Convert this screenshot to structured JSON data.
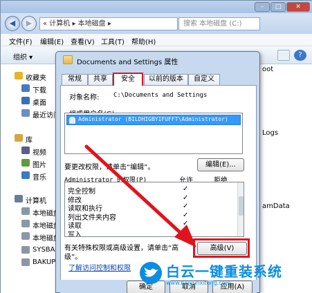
{
  "explorer": {
    "address_prefix": "« 计算机 ▸ 本地磁盘 ▸",
    "search_placeholder": "搜索 本地磁盘 (C:)",
    "menus": [
      "文件(F)",
      "编辑(E)",
      "查看(V)",
      "工具(T)",
      "帮助(H)"
    ],
    "toolbar_organize": "组织 ▾",
    "sidebar": [
      {
        "label": "收藏夹",
        "icon": "star-icon",
        "color": "#e8b422"
      },
      {
        "label": "下载",
        "icon": "download-folder-icon",
        "color": "#4a79c4"
      },
      {
        "label": "桌面",
        "icon": "desktop-icon",
        "color": "#3a6fb8"
      },
      {
        "label": "最近访问",
        "icon": "recent-icon",
        "color": "#6b8fc9"
      },
      {
        "label": "库",
        "icon": "library-icon",
        "color": "#d9a441"
      },
      {
        "label": "视频",
        "icon": "video-icon",
        "color": "#5d5d8a"
      },
      {
        "label": "图片",
        "icon": "pictures-icon",
        "color": "#5f9b3a"
      },
      {
        "label": "音乐",
        "icon": "music-icon",
        "color": "#3c79c8"
      },
      {
        "label": "计算机",
        "icon": "computer-icon",
        "color": "#6a7d96"
      },
      {
        "label": "本地磁盘",
        "icon": "drive-icon",
        "color": "#8c97a6"
      },
      {
        "label": "本地磁盘",
        "icon": "drive-icon",
        "color": "#8c97a6"
      },
      {
        "label": "本地磁盘",
        "icon": "drive-icon",
        "color": "#8c97a6"
      },
      {
        "label": "SYSBAK",
        "icon": "drive-icon",
        "color": "#8c97a6"
      },
      {
        "label": "BAKUP",
        "icon": "drive-icon",
        "color": "#8c97a6"
      }
    ],
    "folders": [
      "oot",
      "Logs",
      "amData"
    ]
  },
  "dialog": {
    "title": "Documents and Settings 属性",
    "tabs": [
      "常规",
      "共享",
      "安全",
      "以前的版本",
      "自定义"
    ],
    "active_tab": "安全",
    "object_name_label": "对象名称:",
    "object_name_value": "C:\\Documents and Settings",
    "group_label": "组或用户名(G):",
    "user_entry": "Administrator (BILDHIGBYIFUFFT\\Administrator)",
    "change_perm_text": "要更改权限，请单击“编辑”。",
    "edit_button": "编辑(E)...",
    "perm_header": "Administrator 的权限(P)",
    "allow_header": "允许",
    "deny_header": "拒绝",
    "permissions": [
      {
        "name": "完全控制",
        "allow": "✓"
      },
      {
        "name": "修改",
        "allow": "✓"
      },
      {
        "name": "读取和执行",
        "allow": "✓"
      },
      {
        "name": "列出文件夹内容",
        "allow": "✓"
      },
      {
        "name": "读取",
        "allow": "✓"
      },
      {
        "name": "写入",
        "allow": "✓"
      }
    ],
    "advanced_text_1": "有关特殊权限或高级设置，请单击“高",
    "advanced_text_2": "级”。",
    "advanced_button": "高级(V)",
    "learn_link": "了解访问控制和权限",
    "ok_button": "确定",
    "cancel_button": "取消",
    "apply_button": "应用(A)"
  },
  "watermark": {
    "title": "白云一键重装系统",
    "url": "www.baiyunxitong.com"
  },
  "accent_red": "#e0141d"
}
